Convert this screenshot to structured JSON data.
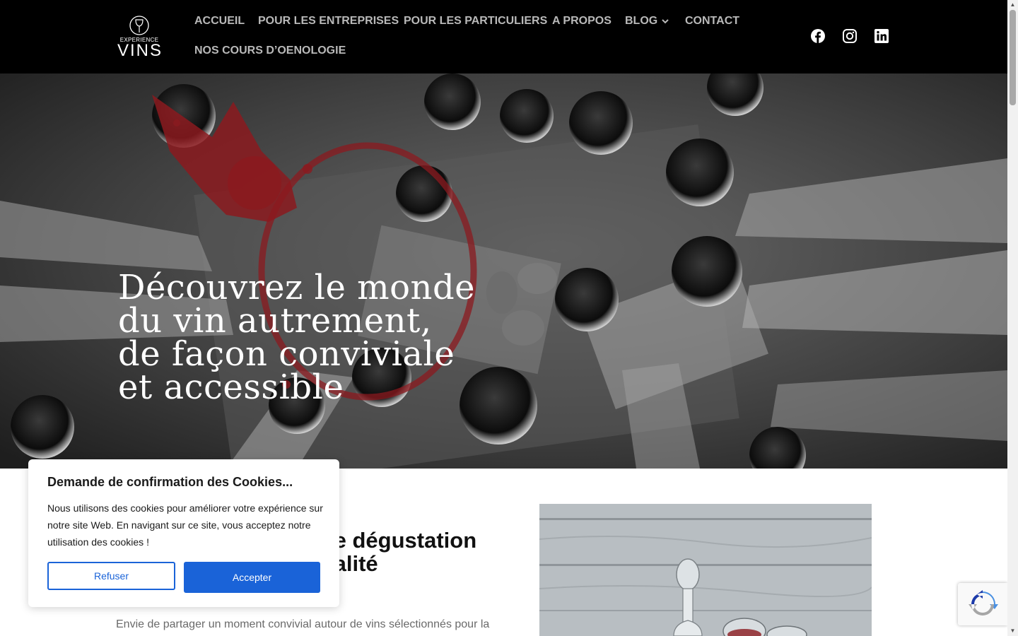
{
  "header": {
    "logo": {
      "small_text": "EXPERIENCE",
      "big_text": "VINS"
    },
    "nav": [
      {
        "label": "ACCUEIL"
      },
      {
        "label": "POUR LES ENTREPRISES"
      },
      {
        "label": "POUR LES PARTICULIERS"
      },
      {
        "label": "A PROPOS"
      },
      {
        "label": "BLOG"
      },
      {
        "label": "CONTACT"
      },
      {
        "label": "NOS COURS D’OENOLOGIE"
      }
    ],
    "social_icons": [
      "facebook-icon",
      "instagram-icon",
      "linkedin-icon"
    ]
  },
  "hero": {
    "title_lines": [
      "Découvrez le monde",
      "du vin autrement,",
      "de façon conviviale",
      "et accessible"
    ]
  },
  "section": {
    "heading_lines": [
      "le dégustation",
      "ialité"
    ],
    "paragraph": "Envie de partager un moment convivial autour de vins sélectionnés pour la"
  },
  "cookie": {
    "title": "Demande de confirmation des Cookies...",
    "text": "Nous utilisons des cookies pour améliorer votre expérience sur notre site Web. En navigant sur ce site, vous acceptez notre utilisation des cookies !",
    "refuse_label": "Refuser",
    "accept_label": "Accepter"
  },
  "colors": {
    "header_bg": "#000000",
    "nav_text": "#b9b9b9",
    "accent_blue": "#1a63d8",
    "wine_red": "#8b1a1f"
  }
}
